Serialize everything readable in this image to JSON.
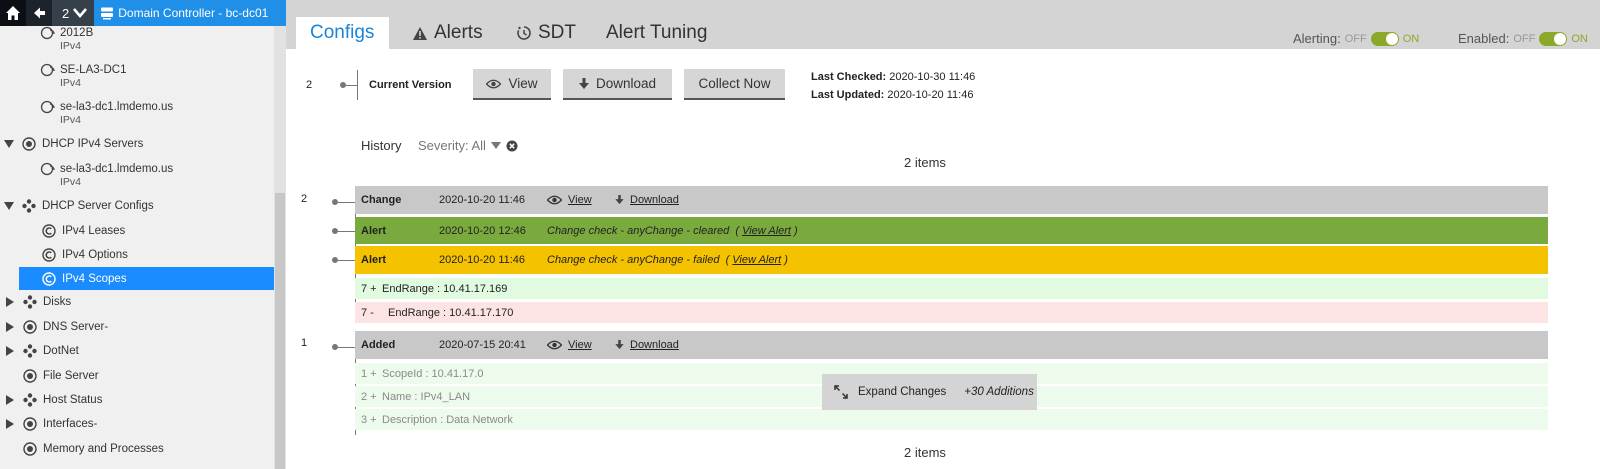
{
  "topbar": {
    "count": "2",
    "breadcrumb": "Domain Controller - bc-dc01"
  },
  "sidebar": {
    "items": [
      {
        "label": "2012B",
        "sub": "IPv4"
      },
      {
        "label": "SE-LA3-DC1",
        "sub": "IPv4"
      },
      {
        "label": "se-la3-dc1.lmdemo.us",
        "sub": "IPv4"
      },
      {
        "label": "DHCP IPv4 Servers"
      },
      {
        "label": "se-la3-dc1.lmdemo.us",
        "sub": "IPv4"
      },
      {
        "label": "DHCP Server Configs"
      },
      {
        "label": "IPv4 Leases"
      },
      {
        "label": "IPv4 Options"
      },
      {
        "label": "IPv4 Scopes"
      },
      {
        "label": "Disks"
      },
      {
        "label": "DNS Server-"
      },
      {
        "label": "DotNet"
      },
      {
        "label": "File Server"
      },
      {
        "label": "Host Status"
      },
      {
        "label": "Interfaces-"
      },
      {
        "label": "Memory and Processes"
      }
    ]
  },
  "tabs": [
    {
      "label": "Configs"
    },
    {
      "label": "Alerts"
    },
    {
      "label": "SDT"
    },
    {
      "label": "Alert Tuning"
    }
  ],
  "alerting": {
    "label": "Alerting:",
    "off": "OFF",
    "on": "ON"
  },
  "enabled": {
    "label": "Enabled:",
    "off": "OFF",
    "on": "ON"
  },
  "current": {
    "num": "2",
    "label": "Current Version",
    "view": "View",
    "download": "Download",
    "collect": "Collect Now",
    "last_checked_label": "Last Checked:",
    "last_checked": "2020-10-30 11:46",
    "last_updated_label": "Last Updated:",
    "last_updated": "2020-10-20 11:46"
  },
  "history": {
    "label": "History",
    "severity": "Severity: All",
    "items_count": "2 items",
    "items_count_bottom": "2 items"
  },
  "versions": [
    {
      "num": "2",
      "rows": [
        {
          "type": "Change",
          "date": "2020-10-20 11:46",
          "view": "View",
          "download": "Download"
        },
        {
          "type": "Alert",
          "date": "2020-10-20 12:46",
          "msg": "Change check - anyChange - cleared",
          "link": "View Alert"
        },
        {
          "type": "Alert",
          "date": "2020-10-20 11:46",
          "msg": "Change check - anyChange - failed",
          "link": "View Alert"
        }
      ],
      "diffs": [
        {
          "prefix": "7 +",
          "text": "EndRange : 10.41.17.169"
        },
        {
          "prefix": "7 -",
          "text": "EndRange : 10.41.17.170"
        }
      ]
    },
    {
      "num": "1",
      "rows": [
        {
          "type": "Added",
          "date": "2020-07-15 20:41",
          "view": "View",
          "download": "Download"
        }
      ],
      "diffs": [
        {
          "prefix": "1 +",
          "text": "ScopeId : 10.41.17.0"
        },
        {
          "prefix": "2 +",
          "text": "Name : IPv4_LAN"
        },
        {
          "prefix": "3 +",
          "text": "Description : Data Network"
        }
      ]
    }
  ],
  "expand": {
    "label": "Expand Changes",
    "count": "+30 Additions"
  }
}
